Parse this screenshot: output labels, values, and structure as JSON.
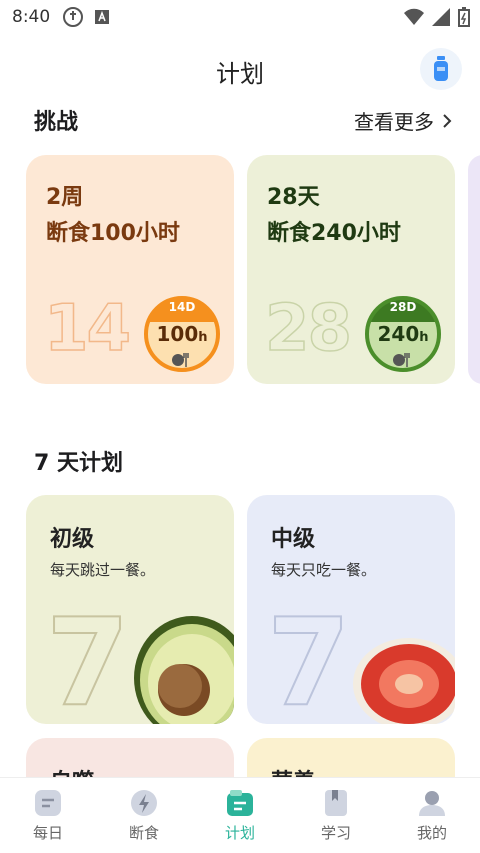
{
  "status_bar": {
    "time": "8:40"
  },
  "header": {
    "title": "计划"
  },
  "challenges": {
    "heading": "挑战",
    "see_more": "查看更多",
    "cards": [
      {
        "line1": "2周",
        "line2": "断食100小时",
        "big_number": "14",
        "badge_top": "14D",
        "badge_value": "100",
        "badge_unit": "h"
      },
      {
        "line1": "28天",
        "line2": "断食240小时",
        "big_number": "28",
        "badge_top": "28D",
        "badge_value": "240",
        "badge_unit": "h"
      }
    ]
  },
  "plans": {
    "heading": "7 天计划",
    "cards": [
      {
        "title": "初级",
        "desc": "每天跳过一餐。",
        "number": "7"
      },
      {
        "title": "中级",
        "desc": "每天只吃一餐。",
        "number": "7"
      },
      {
        "title": "自噬",
        "desc": ""
      },
      {
        "title": "营养",
        "desc": ""
      }
    ]
  },
  "bottom_nav": [
    {
      "label": "每日",
      "icon": "daily-icon"
    },
    {
      "label": "断食",
      "icon": "lightning-icon"
    },
    {
      "label": "计划",
      "icon": "plan-icon",
      "active": true
    },
    {
      "label": "学习",
      "icon": "bookmark-icon"
    },
    {
      "label": "我的",
      "icon": "person-icon"
    }
  ],
  "colors": {
    "accent": "#2bb39a"
  }
}
